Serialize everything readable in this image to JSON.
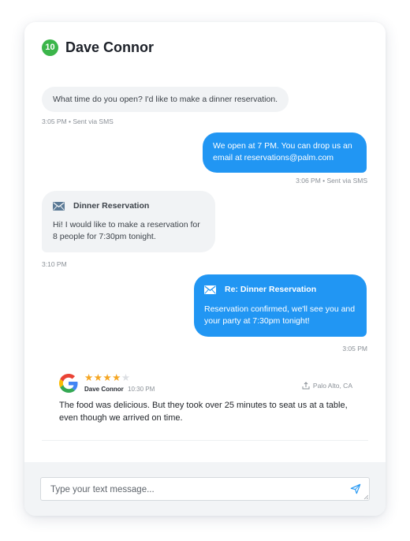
{
  "conversation": {
    "badge": "10",
    "contact_name": "Dave Connor"
  },
  "messages": [
    {
      "text": "What time do you open? I'd like to make a dinner reservation.",
      "meta": "3:05 PM • Sent via SMS"
    },
    {
      "text": "We open at 7 PM. You can drop us an email at reservations@palm.com",
      "meta": "3:06 PM • Sent via SMS"
    },
    {
      "subject": "Dinner Reservation",
      "text": "Hi! I would like to make a reservation for 8 people for 7:30pm tonight.",
      "meta": "3:10 PM"
    },
    {
      "subject": "Re: Dinner Reservation",
      "text": "Reservation confirmed, we'll see you and your party at 7:30pm tonight!",
      "meta": "3:05 PM"
    }
  ],
  "review": {
    "rating": 4,
    "max_rating": 5,
    "author": "Dave Connor",
    "time": "10:30 PM",
    "location": "Palo Alto, CA",
    "text": "The food was delicious. But they took over 25 minutes to seat us at a table, even though we arrived on time."
  },
  "composer": {
    "placeholder": "Type your text message..."
  },
  "colors": {
    "badge": "#3bb54a",
    "outgoing_bubble": "#2196f3",
    "incoming_bubble": "#f1f3f5",
    "star": "#f5a623"
  },
  "icons": [
    "mail-icon",
    "google-icon",
    "star-icon",
    "location-pin-icon",
    "send-icon",
    "resize-grip-icon"
  ]
}
